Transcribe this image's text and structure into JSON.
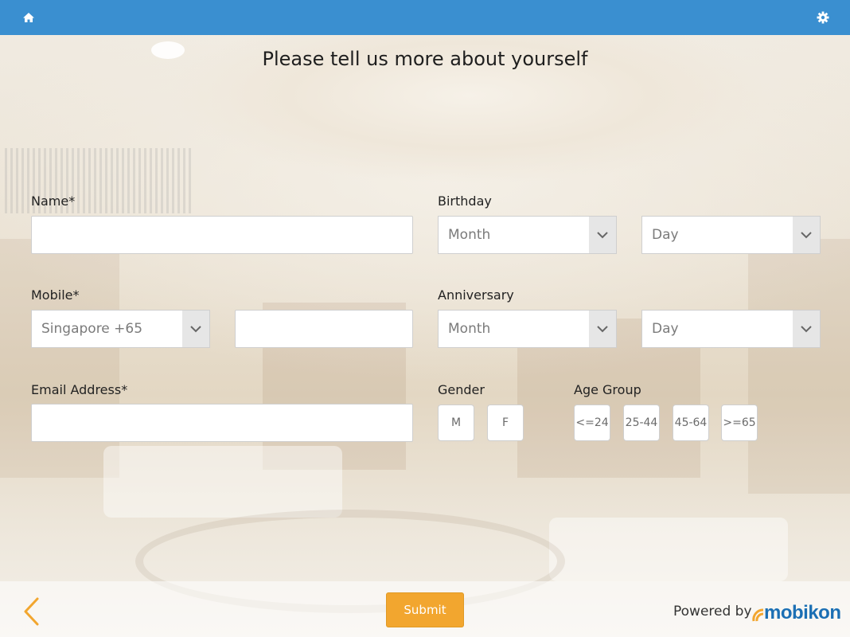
{
  "header": {
    "home_icon": "home-icon",
    "settings_icon": "gear-icon",
    "bar_color": "#3a8fd0"
  },
  "page": {
    "title": "Please tell us more about yourself"
  },
  "form": {
    "name": {
      "label": "Name*",
      "value": ""
    },
    "mobile": {
      "label": "Mobile*",
      "country_code": "Singapore +65",
      "value": ""
    },
    "email": {
      "label": "Email Address*",
      "value": ""
    },
    "birthday": {
      "label": "Birthday",
      "month": "Month",
      "day": "Day"
    },
    "anniversary": {
      "label": "Anniversary",
      "month": "Month",
      "day": "Day"
    },
    "gender": {
      "label": "Gender",
      "options": [
        "M",
        "F"
      ]
    },
    "age_group": {
      "label": "Age Group",
      "options": [
        "<=24",
        "25-44",
        "45-64",
        ">=65"
      ]
    }
  },
  "footer": {
    "back_icon": "chevron-left-icon",
    "submit_label": "Submit",
    "powered_by": "Powered by",
    "brand": "mobikon",
    "accent_color": "#f2a62f",
    "brand_color": "#1b6fb4"
  }
}
